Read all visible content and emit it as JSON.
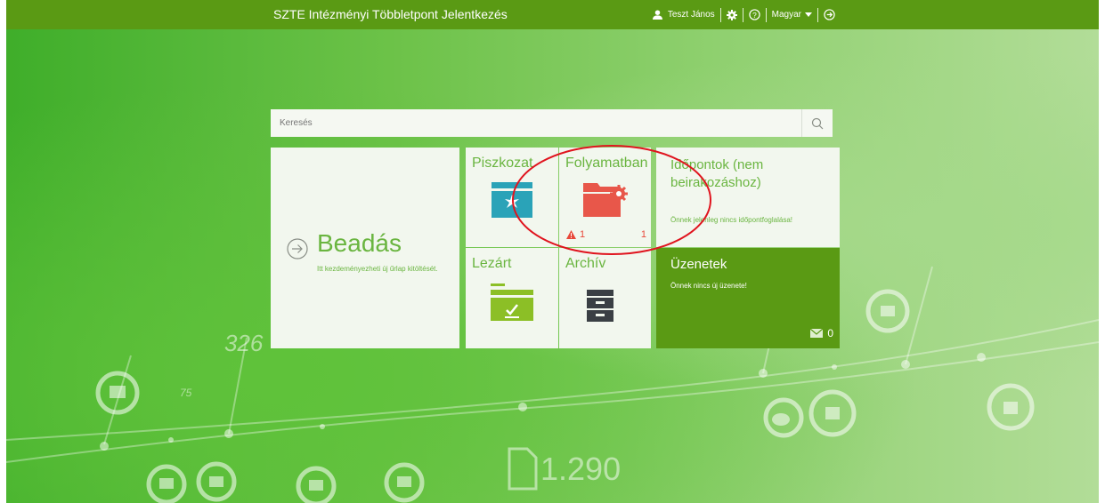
{
  "header": {
    "title": "SZTE Intézményi Többletpont Jelentkezés",
    "user_name": "Teszt János",
    "language": "Magyar"
  },
  "search": {
    "placeholder": "Keresés"
  },
  "tiles": {
    "beadas": {
      "title": "Beadás",
      "description": "Itt kezdeményezheti új űrlap kitöltését."
    },
    "piszkozat": {
      "title": "Piszkozat"
    },
    "folyamatban": {
      "title": "Folyamatban",
      "alert_count": "1",
      "count": "1"
    },
    "lezart": {
      "title": "Lezárt"
    },
    "archiv": {
      "title": "Archív"
    },
    "idopontok": {
      "title": "Időpontok (nem beirakozáshoz)",
      "description": "Önnek jelenleg nincs időpontfoglalása!"
    },
    "uzenetek": {
      "title": "Üzenetek",
      "description": "Önnek nincs új üzenete!",
      "count": "0"
    }
  },
  "background": {
    "num_1": "326",
    "num_2": "75",
    "num_3": "1.290"
  },
  "colors": {
    "header": "#5a9a14",
    "accent_green": "#6ab540",
    "draft_icon": "#2aa3b8",
    "in_progress_icon": "#e8574a",
    "closed_icon": "#8cbf26",
    "archive_icon": "#3a3f44",
    "annotation": "#e0141e"
  },
  "icons": [
    "user-icon",
    "gear-icon",
    "help-icon",
    "caret-down-icon",
    "logout-icon",
    "search-icon",
    "arrow-right-circle-icon",
    "draft-box-icon",
    "folder-gear-icon",
    "warning-icon",
    "folder-check-icon",
    "archive-cabinet-icon",
    "envelope-icon"
  ]
}
